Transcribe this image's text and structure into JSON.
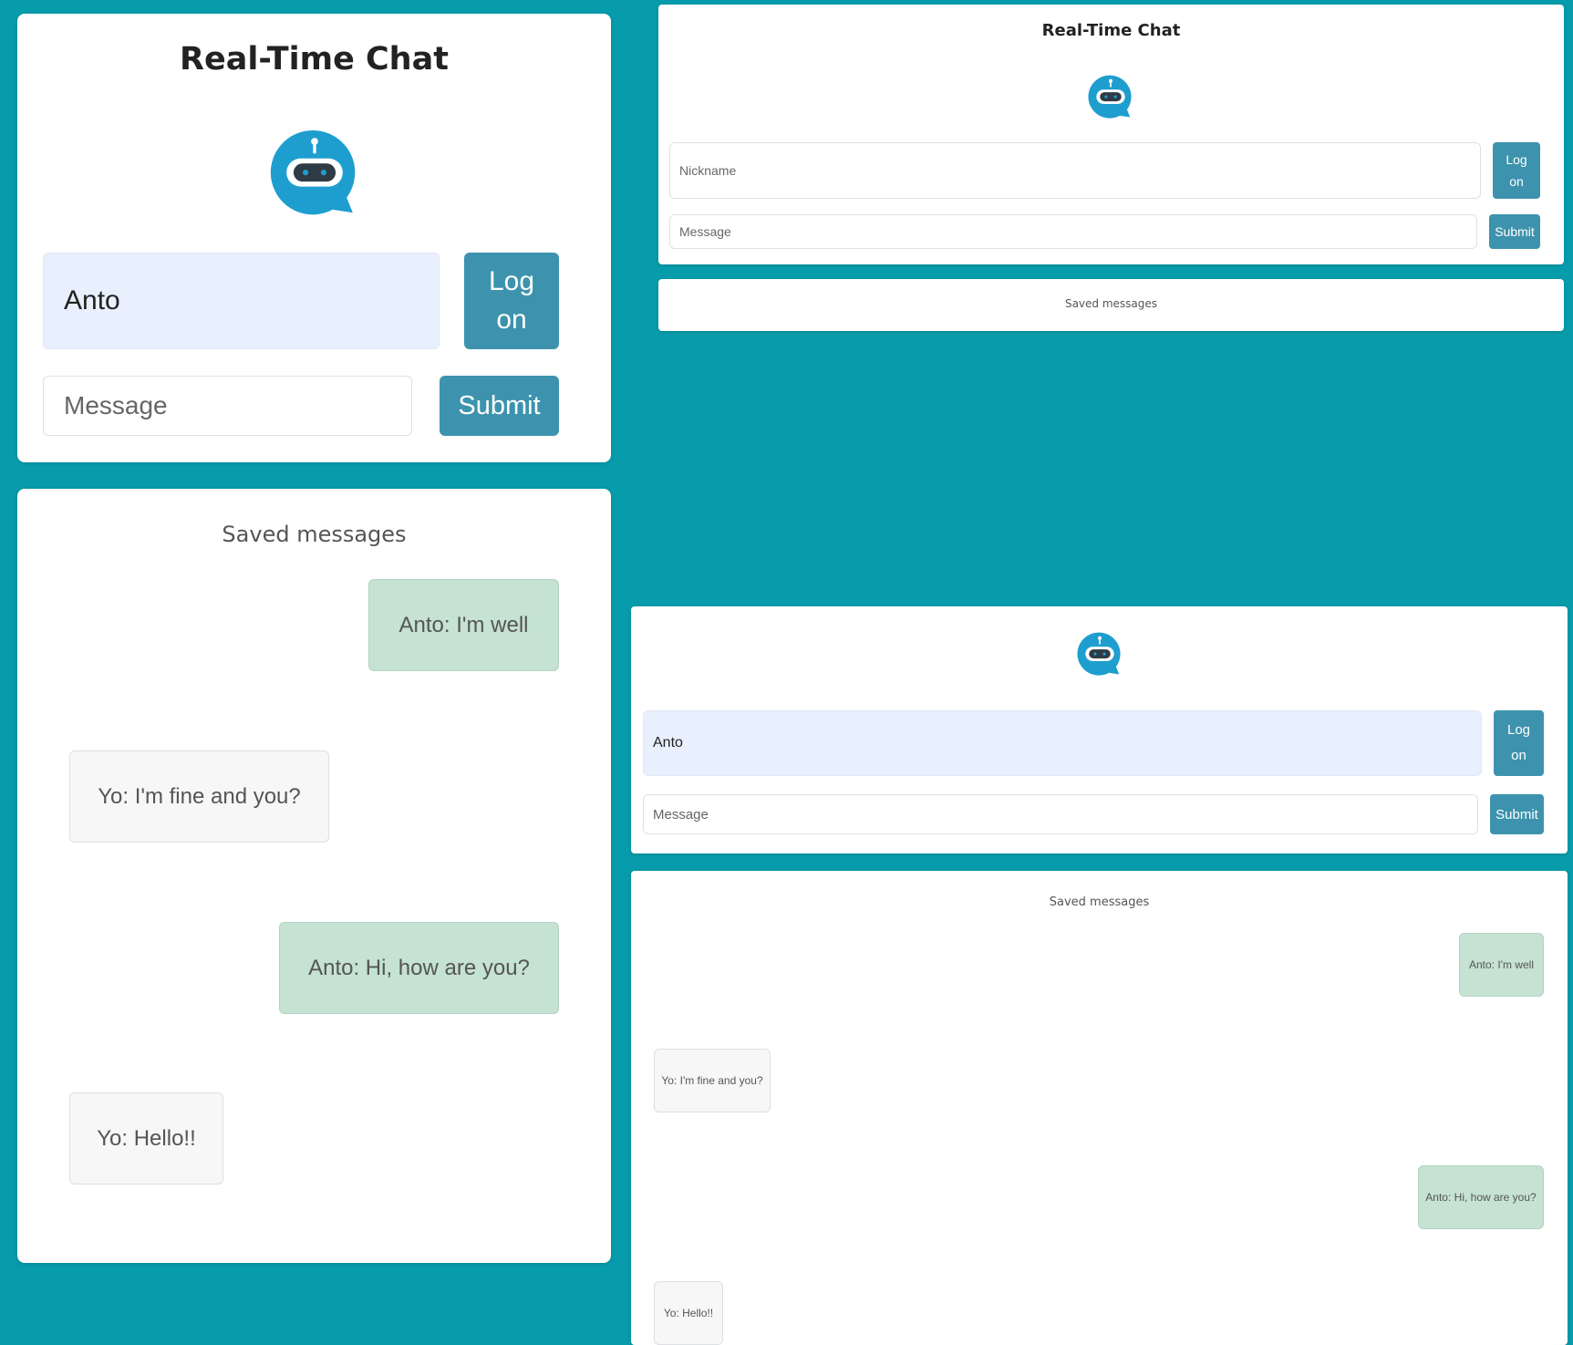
{
  "app": {
    "title": "Real-Time Chat",
    "saved_title": "Saved messages",
    "accent": "#3d93ad",
    "background": "#079cab"
  },
  "panel_large": {
    "nickname_value": "Anto",
    "logon_line1": "Log",
    "logon_line2": "on",
    "message_placeholder": "Message",
    "submit_label": "Submit",
    "messages": [
      {
        "text": "Anto: I'm well",
        "mine": true
      },
      {
        "text": "Yo: I'm fine and you?",
        "mine": false
      },
      {
        "text": "Anto: Hi, how are you?",
        "mine": true
      },
      {
        "text": "Yo: Hello!!",
        "mine": false
      }
    ]
  },
  "panel_top_right": {
    "nickname_placeholder": "Nickname",
    "logon_line1": "Log",
    "logon_line2": "on",
    "message_placeholder": "Message",
    "submit_label": "Submit"
  },
  "panel_bottom_right": {
    "nickname_value": "Anto",
    "logon_line1": "Log",
    "logon_line2": "on",
    "message_placeholder": "Message",
    "submit_label": "Submit",
    "messages": [
      {
        "text": "Anto: I'm well",
        "mine": true
      },
      {
        "text": "Yo: I'm fine and you?",
        "mine": false
      },
      {
        "text": "Anto: Hi, how are you?",
        "mine": true
      },
      {
        "text": "Yo: Hello!!",
        "mine": false
      }
    ]
  }
}
